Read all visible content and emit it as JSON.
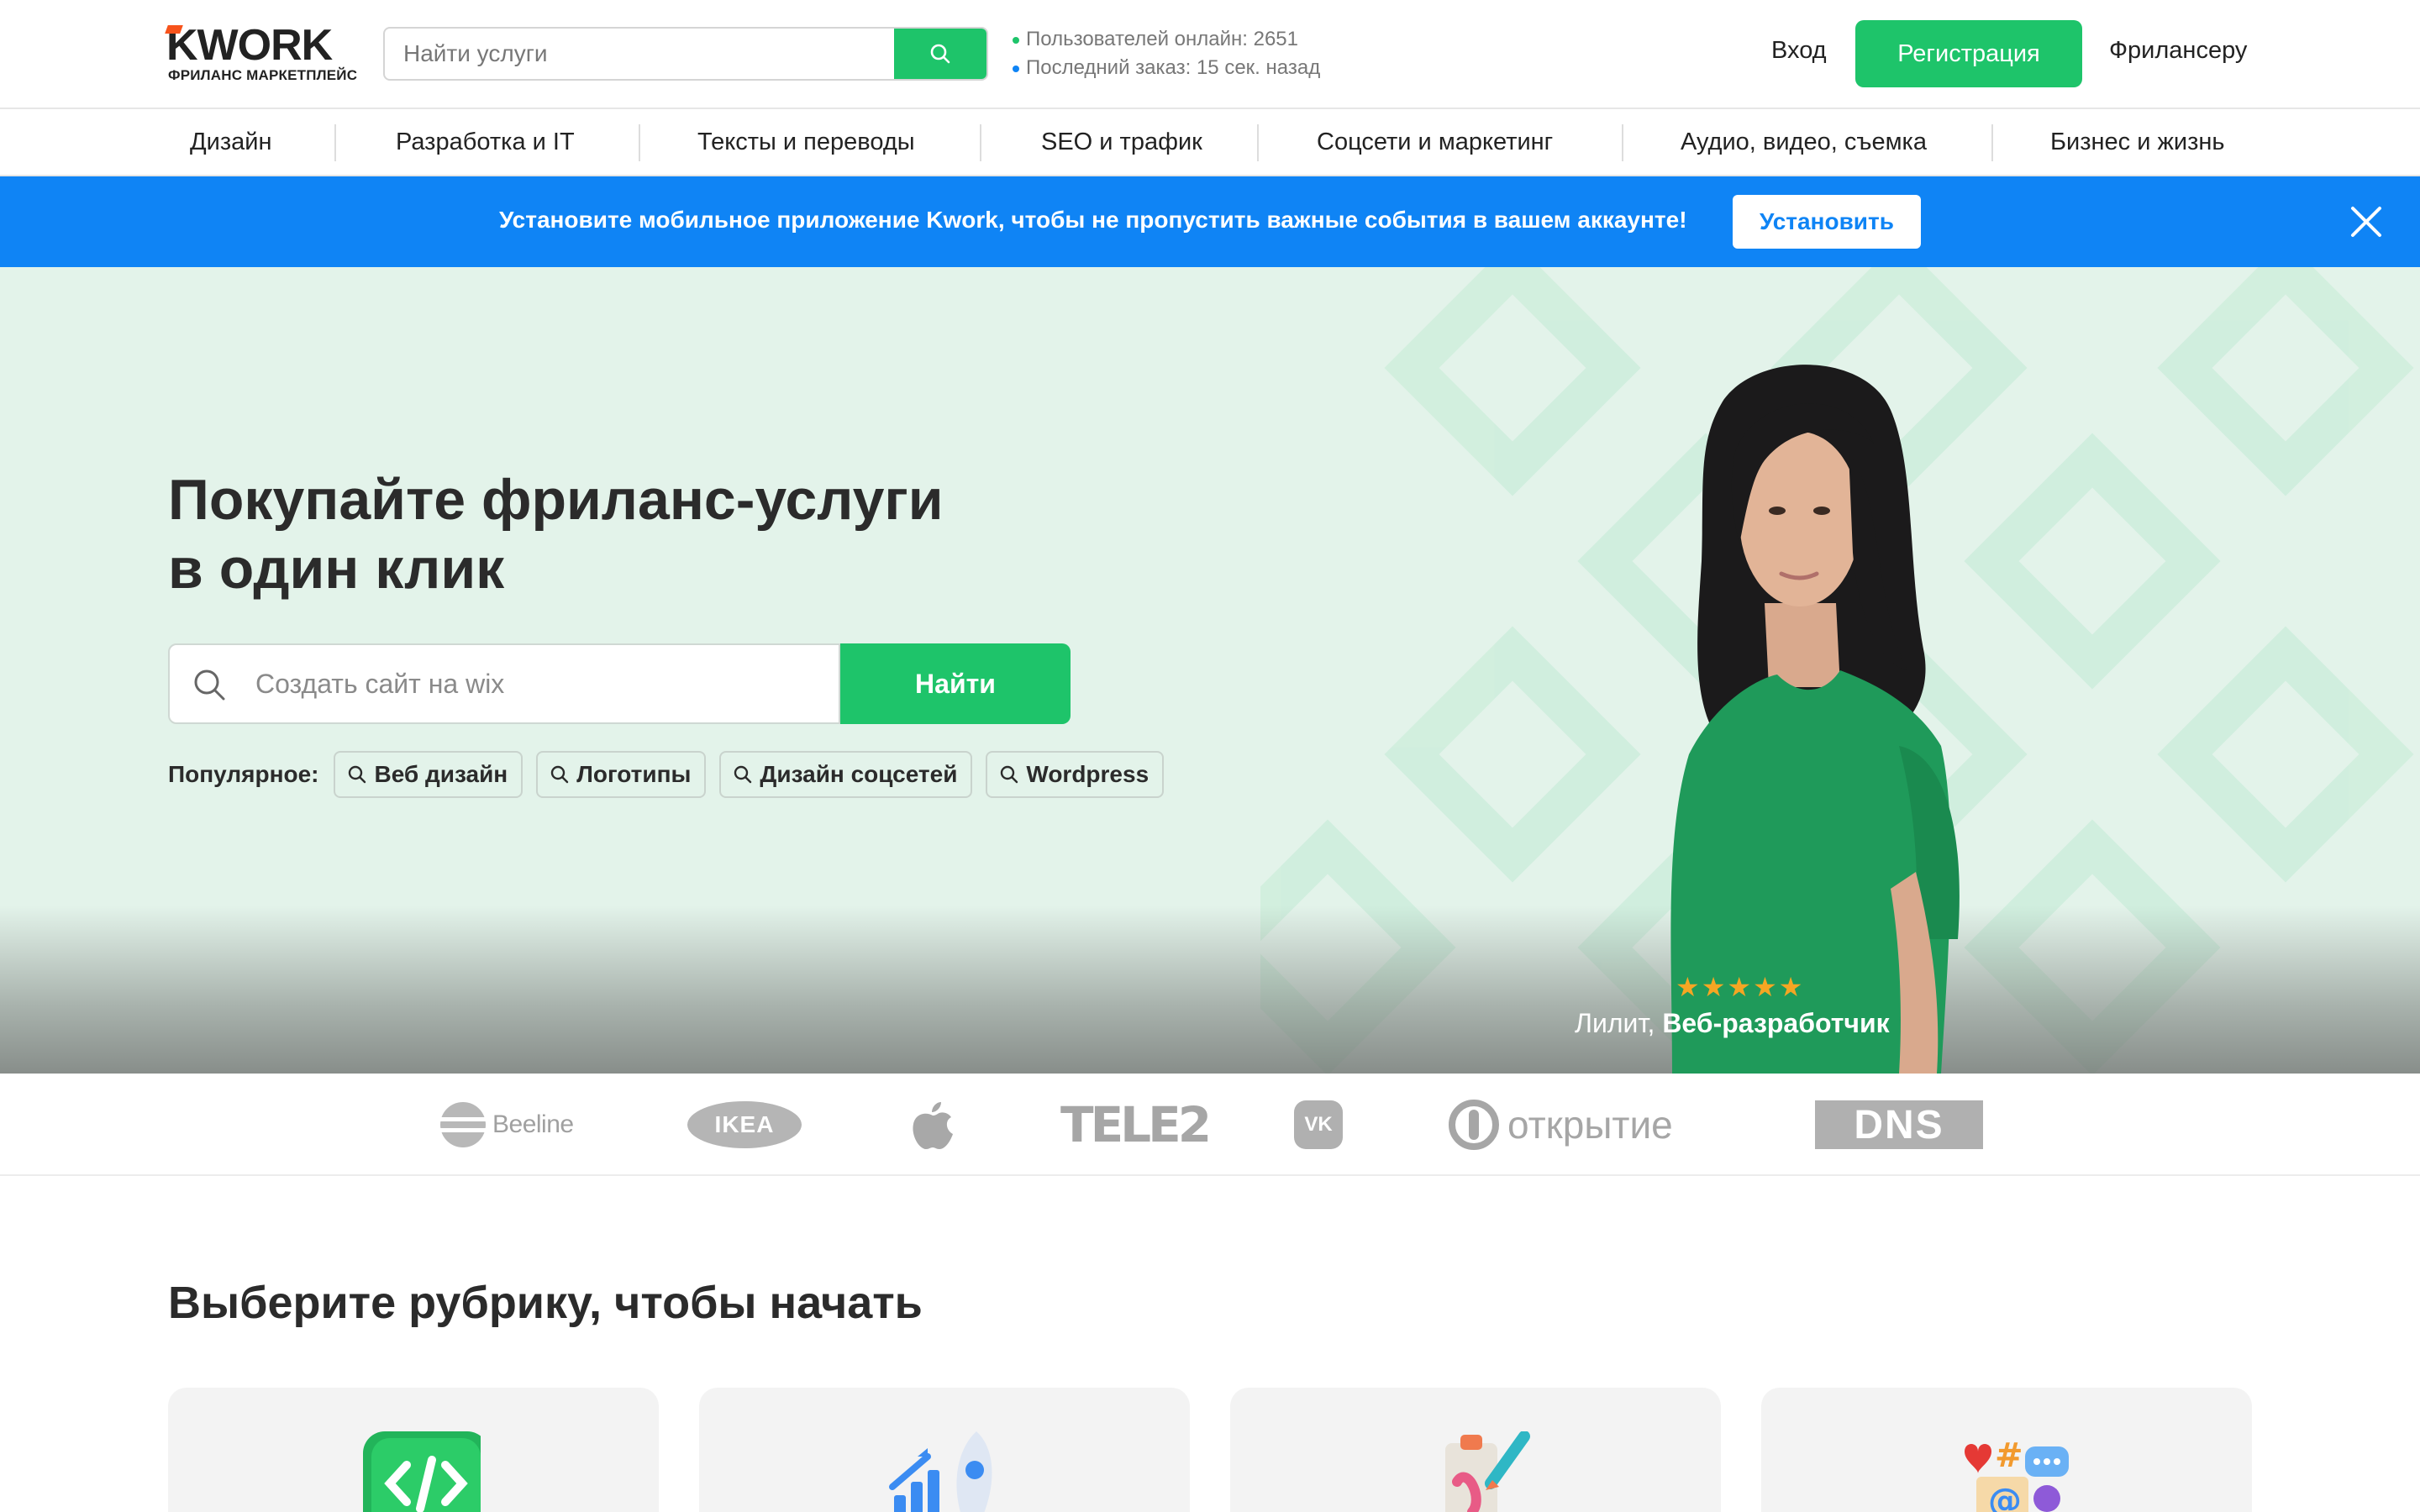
{
  "header": {
    "logo_word": "KWORK",
    "logo_sub": "ФРИЛАНС МАРКЕТПЛЕЙС",
    "search_placeholder": "Найти услуги",
    "stats_online": "Пользователей онлайн: 2651",
    "stats_last_order": "Последний заказ: 15 сек. назад",
    "login": "Вход",
    "register": "Регистрация",
    "freelancer": "Фрилансеру"
  },
  "categories": [
    "Дизайн",
    "Разработка и IT",
    "Тексты и переводы",
    "SEO и трафик",
    "Соцсети и маркетинг",
    "Аудио, видео, съемка",
    "Бизнес и жизнь"
  ],
  "banner": {
    "text": "Установите мобильное приложение Kwork, чтобы не пропустить важные события в вашем аккаунте!",
    "install": "Установить"
  },
  "hero": {
    "title_line1": "Покупайте фриланс-услуги",
    "title_line2": "в один клик",
    "search_placeholder": "Создать сайт на wix",
    "search_button": "Найти",
    "popular_label": "Популярное:",
    "popular": [
      "Веб дизайн",
      "Логотипы",
      "Дизайн соцсетей",
      "Wordpress"
    ],
    "stars": "★★★★★",
    "person_name": "Лилит,",
    "person_role": "Веб-разработчик"
  },
  "brands": [
    "Beeline",
    "IKEA",
    "apple",
    "TELE2",
    "VK",
    "открытие",
    "DNS"
  ],
  "section": {
    "title": "Выберите рубрику, чтобы начать",
    "cards": [
      "code-icon",
      "rocket-chart-icon",
      "design-brush-icon",
      "social-icons-icon"
    ]
  },
  "colors": {
    "accent": "#1ec46a",
    "banner": "#0f84f5",
    "hero_bg": "#e3f3ea",
    "logo_mark": "#f7531b"
  }
}
